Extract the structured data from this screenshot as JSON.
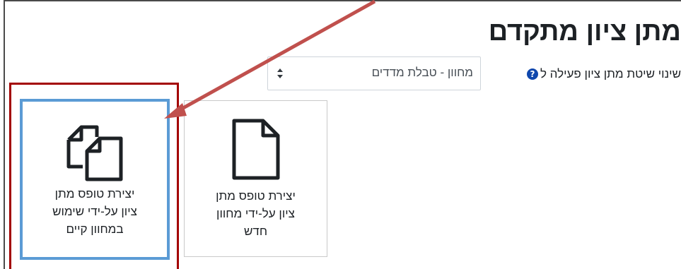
{
  "page": {
    "title": "מתן ציון מתקדם",
    "method_label": "שינוי שיטת מתן ציון פעילה ל",
    "help_icon": "?",
    "method_select": {
      "value": "מחוון - טבלת מדדים"
    }
  },
  "tiles": {
    "new": {
      "lines": [
        "יצירת טופס מתן",
        "ציון על-ידי מחוון",
        "חדש"
      ]
    },
    "existing": {
      "lines": [
        "יצירת טופס מתן",
        "ציון על-ידי שימוש",
        "במחוון קיים"
      ]
    }
  },
  "colors": {
    "annotation_red": "#a30000",
    "arrow_red": "#c0504d",
    "highlight_blue": "#5b9bd5",
    "help_icon_blue": "#0f47ad"
  }
}
